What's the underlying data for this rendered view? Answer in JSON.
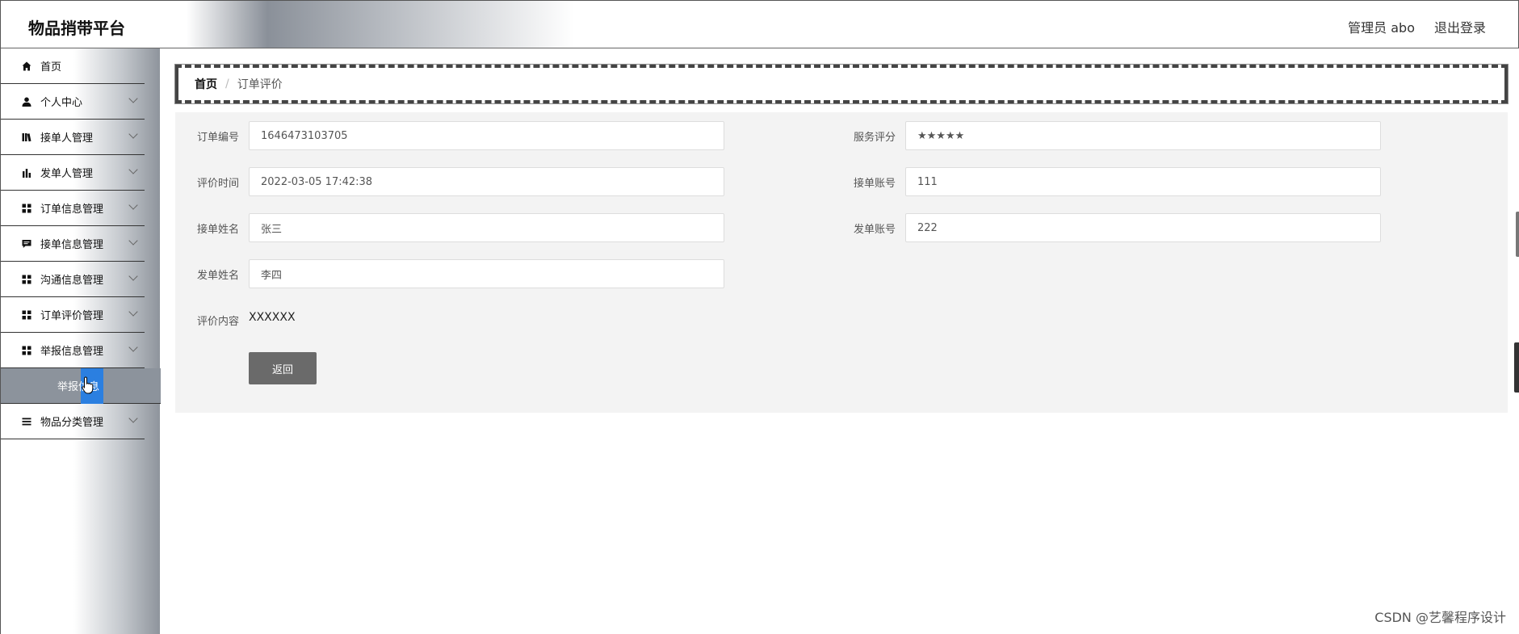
{
  "header": {
    "title": "物品捎带平台",
    "user": "管理员 abo",
    "logout": "退出登录"
  },
  "sidebar": {
    "items": [
      {
        "label": "首页",
        "icon": "home-icon"
      },
      {
        "label": "个人中心",
        "icon": "user-icon"
      },
      {
        "label": "接单人管理",
        "icon": "book-icon"
      },
      {
        "label": "发单人管理",
        "icon": "bar-chart-icon"
      },
      {
        "label": "订单信息管理",
        "icon": "grid-icon"
      },
      {
        "label": "接单信息管理",
        "icon": "comment-icon"
      },
      {
        "label": "沟通信息管理",
        "icon": "grid-icon"
      },
      {
        "label": "订单评价管理",
        "icon": "grid-icon"
      },
      {
        "label": "举报信息管理",
        "icon": "grid-icon"
      }
    ],
    "submenu_active": "举报信息",
    "last_item": {
      "label": "物品分类管理",
      "icon": "list-icon"
    }
  },
  "breadcrumb": {
    "home": "首页",
    "separator": "/",
    "current": "订单评价"
  },
  "form": {
    "order_no_label": "订单编号",
    "order_no": "1646473103705",
    "rating_label": "服务评分",
    "rating": "★★★★★",
    "eval_time_label": "评价时间",
    "eval_time": "2022-03-05 17:42:38",
    "taker_account_label": "接单账号",
    "taker_account": "111",
    "taker_name_label": "接单姓名",
    "taker_name": "张三",
    "sender_account_label": "发单账号",
    "sender_account": "222",
    "sender_name_label": "发单姓名",
    "sender_name": "李四",
    "content_label": "评价内容",
    "content": "XXXXXX",
    "back_button": "返回"
  },
  "watermark": "CSDN @艺馨程序设计"
}
